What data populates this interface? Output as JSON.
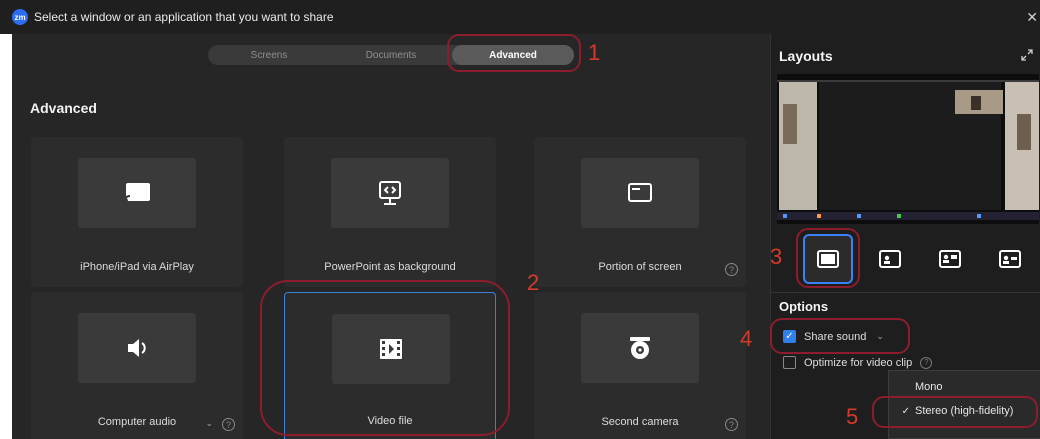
{
  "window": {
    "title": "Select a window or an application that you want to share",
    "logo_text": "zm"
  },
  "tabs": [
    {
      "label": "Screens"
    },
    {
      "label": "Documents"
    },
    {
      "label": "Advanced"
    }
  ],
  "section": {
    "title": "Advanced"
  },
  "cards": [
    {
      "label": "iPhone/iPad via AirPlay",
      "icon": "airplay-icon"
    },
    {
      "label": "PowerPoint as background",
      "icon": "powerpoint-icon"
    },
    {
      "label": "Portion of screen",
      "icon": "portion-screen-icon",
      "help": "?"
    },
    {
      "label": "Computer audio",
      "icon": "speaker-icon",
      "help": "?"
    },
    {
      "label": "Video file",
      "icon": "video-file-icon"
    },
    {
      "label": "Second camera",
      "icon": "camera-icon",
      "help": "?"
    }
  ],
  "right_panel": {
    "layouts_title": "Layouts",
    "options_title": "Options",
    "share_sound_label": "Share sound",
    "optimize_label": "Optimize for video clip",
    "help": "?"
  },
  "dropdown": {
    "items": [
      {
        "label": "Mono",
        "checked": ""
      },
      {
        "label": "Stereo (high-fidelity)",
        "checked": "✓"
      }
    ]
  },
  "annotations": [
    "1",
    "2",
    "3",
    "4",
    "5"
  ],
  "colors": {
    "accent": "#2f80ed",
    "annotation": "#8b1d2c",
    "annotation_text": "#d63a2a"
  }
}
